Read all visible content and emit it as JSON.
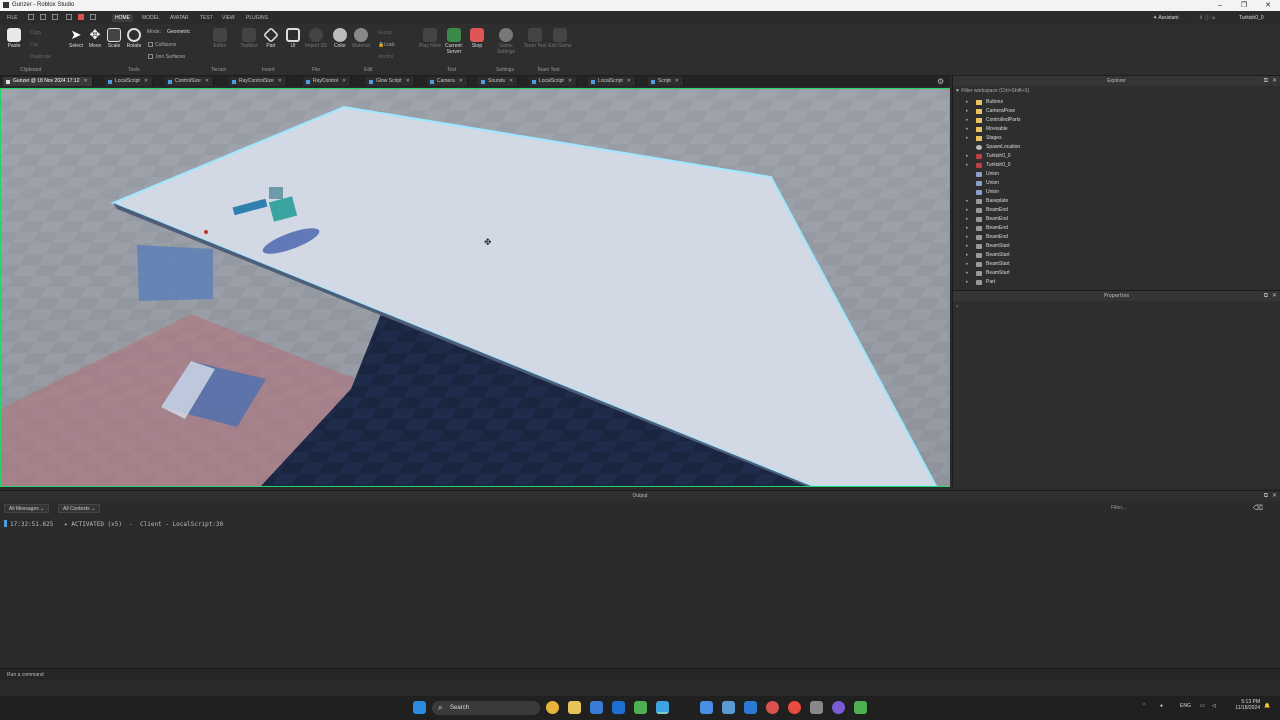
{
  "window": {
    "title": "Gunzer - Roblox Studio",
    "controls": [
      "–",
      "❐",
      "✕"
    ]
  },
  "menubar": {
    "file_label": "FILE",
    "tabs": [
      "HOME",
      "MODEL",
      "AVATAR",
      "TEST",
      "VIEW",
      "PLUGINS"
    ],
    "active_tab": "HOME",
    "assistant_label": "Assistant",
    "user_label": "Turkish0_0"
  },
  "ribbon": {
    "clipboard": {
      "paste": "Paste",
      "copy": "Copy",
      "cut": "Cut",
      "duplicate": "Duplicate",
      "group": "Clipboard"
    },
    "tools": {
      "select": "Select",
      "move": "Move",
      "scale": "Scale",
      "rotate": "Rotate",
      "mode_label": "Mode:",
      "mode_value": "Geometric",
      "collisions": "Collisions",
      "join_surfaces": "Join Surfaces",
      "group": "Tools"
    },
    "terrain": {
      "editor": "Editor",
      "group": "Terrain"
    },
    "insert": {
      "toolbox": "Toolbox",
      "part": "Part",
      "ui": "UI",
      "group": "Insert"
    },
    "file": {
      "import3d": "Import 3D",
      "group": "File"
    },
    "edit": {
      "color": "Color",
      "material": "Material",
      "group_btn": "Group",
      "lock": "Lock",
      "anchor": "Anchor",
      "group": "Edit"
    },
    "test": {
      "play_here": "Play Here",
      "current_server": "Current: Server",
      "stop": "Stop",
      "group": "Test"
    },
    "settings": {
      "game_settings": "Game Settings",
      "group": "Settings"
    },
    "team_test": {
      "team_test": "Team Test",
      "exit_game": "Exit Game",
      "group": "Team Test"
    }
  },
  "doc_tabs": [
    {
      "label": "Gunzer @ 18 Nov 2024 17:12",
      "active": true
    },
    {
      "label": "LocalScript"
    },
    {
      "label": "ControlSize"
    },
    {
      "label": "RayControlSize"
    },
    {
      "label": "RayControl"
    },
    {
      "label": "Glow Script"
    },
    {
      "label": "Camera"
    },
    {
      "label": "Sounds"
    },
    {
      "label": "LocalScript"
    },
    {
      "label": "LocalScript"
    },
    {
      "label": "Script"
    }
  ],
  "explorer": {
    "title": "Explorer",
    "filter_placeholder": "Filter workspace (Ctrl+Shift+X)",
    "items": [
      {
        "label": "Buttons",
        "icon": "folder-icon",
        "expandable": true
      },
      {
        "label": "CameraPose",
        "icon": "folder-icon",
        "expandable": true
      },
      {
        "label": "ControlledParts",
        "icon": "folder-icon",
        "expandable": true
      },
      {
        "label": "Moveable",
        "icon": "folder-icon",
        "expandable": true
      },
      {
        "label": "Stages",
        "icon": "folder-icon",
        "expandable": true
      },
      {
        "label": "SpawnLocation",
        "icon": "spawn-icon",
        "expandable": false
      },
      {
        "label": "Turkish0_0",
        "icon": "model-icon",
        "expandable": true
      },
      {
        "label": "Turkish0_0",
        "icon": "model-icon",
        "expandable": true
      },
      {
        "label": "Union",
        "icon": "union-icon",
        "expandable": false
      },
      {
        "label": "Union",
        "icon": "union-icon",
        "expandable": false
      },
      {
        "label": "Union",
        "icon": "union-icon",
        "expandable": false
      },
      {
        "label": "Baseplate",
        "icon": "part-icon",
        "expandable": true
      },
      {
        "label": "BeamEnd",
        "icon": "part-icon",
        "expandable": true
      },
      {
        "label": "BeamEnd",
        "icon": "part-icon",
        "expandable": true
      },
      {
        "label": "BeamEnd",
        "icon": "part-icon",
        "expandable": true
      },
      {
        "label": "BeamEnd",
        "icon": "part-icon",
        "expandable": true
      },
      {
        "label": "BeamStart",
        "icon": "part-icon",
        "expandable": true
      },
      {
        "label": "BeamStart",
        "icon": "part-icon",
        "expandable": true
      },
      {
        "label": "BeamStart",
        "icon": "part-icon",
        "expandable": true
      },
      {
        "label": "BeamStart",
        "icon": "part-icon",
        "expandable": true
      },
      {
        "label": "Part",
        "icon": "part-icon",
        "expandable": true
      }
    ]
  },
  "properties": {
    "title": "Properties"
  },
  "output": {
    "title": "Output",
    "messages_filter": "All Messages",
    "contexts_filter": "All Contexts",
    "filter_placeholder": "Filter...",
    "log": [
      {
        "time": "17:32:51.625",
        "text": "▸ ACTIVATED (x5)  -  Client - LocalScript:30"
      }
    ]
  },
  "command_bar": {
    "placeholder": "Run a command"
  },
  "taskbar": {
    "search_label": "Search",
    "language": "ENG",
    "time": "5:13 PM",
    "date": "11/18/2024"
  },
  "colors": {
    "selection_outline": "#27d36a",
    "part_surface": "#d3dbe6",
    "stop_button": "#e05555"
  }
}
